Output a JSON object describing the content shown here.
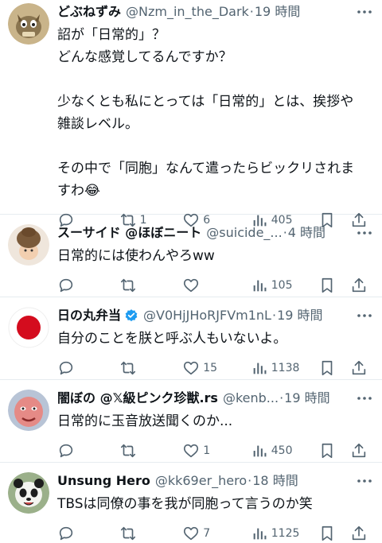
{
  "posts": [
    {
      "name": "どぶねずみ",
      "handle": "@Nzm_in_the_Dark",
      "sep": "·",
      "time": "19 時間",
      "lines": [
        "詔が「日常的」？",
        "どんな感覚してるんですか？",
        "",
        "少なくとも私にとっては「日常的」とは、挨拶や",
        "雑談レベル。",
        "",
        "その中で「同胞」なんて遣ったらビックリされま",
        "すわ😂"
      ],
      "replies": "",
      "retweets": "1",
      "likes": "6",
      "views": "405"
    },
    {
      "name": "スーサイド @ほぼニート",
      "handle": "@suicide_...",
      "sep": "·",
      "time": "4 時間",
      "lines": [
        "日常的には使わんやろww"
      ],
      "replies": "",
      "retweets": "",
      "likes": "",
      "views": "105"
    },
    {
      "name": "日の丸弁当",
      "handle": "@V0HjJHoRJFVm1nL",
      "sep": "·",
      "time": "19 時間",
      "lines": [
        "自分のことを朕と呼ぶ人もいないよ。"
      ],
      "replies": "",
      "retweets": "",
      "likes": "15",
      "views": "1138"
    },
    {
      "name": "闇ぼの @𝕏級ピンク珍獣.rs",
      "handle": "@kenb...",
      "sep": "·",
      "time": "19 時間",
      "lines": [
        "日常的に玉音放送聞くのか..."
      ],
      "replies": "",
      "retweets": "",
      "likes": "1",
      "views": "450"
    },
    {
      "name": "Unsung Hero",
      "handle": "@kk69er_hero",
      "sep": "·",
      "time": "18 時間",
      "lines": [
        "TBSは同僚の事を我が同胞って言うのか笑"
      ],
      "replies": "",
      "retweets": "",
      "likes": "7",
      "views": "1125"
    }
  ]
}
